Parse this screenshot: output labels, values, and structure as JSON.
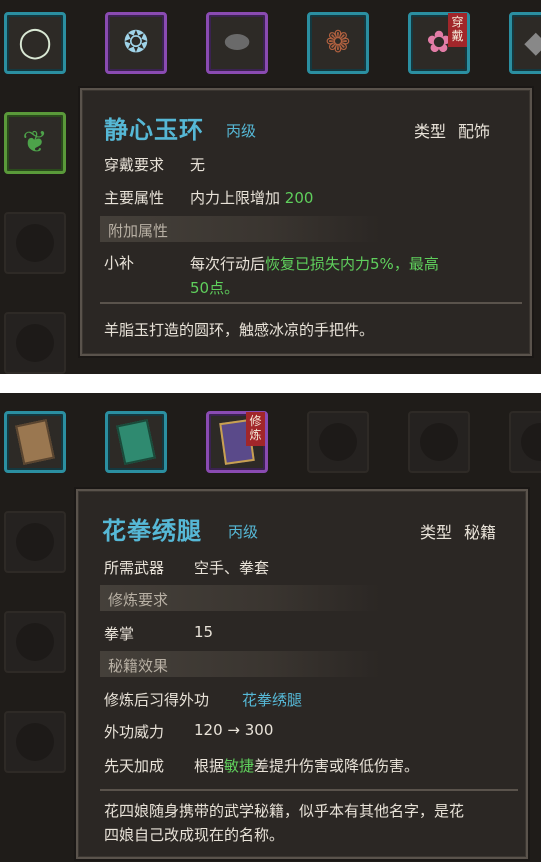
{
  "panel1": {
    "slots": [
      {
        "icon_name": "jade-ring-icon",
        "glyph": "◯",
        "color": "#d9e8d4"
      },
      {
        "icon_name": "jade-bracelet-icon",
        "glyph": "❂",
        "color": "#9fd3e8"
      },
      {
        "icon_name": "dark-leaf-icon",
        "glyph": "⬬",
        "color": "#5a5a5a"
      },
      {
        "icon_name": "prayer-beads-icon",
        "glyph": "❁",
        "color": "#a4553a"
      },
      {
        "icon_name": "peony-flower-icon",
        "glyph": "✿",
        "color": "#e27ca6",
        "tag": [
          "穿",
          "戴"
        ]
      },
      {
        "icon_name": "partial-item-icon",
        "glyph": "◆",
        "color": "#777"
      }
    ],
    "left_slot": {
      "icon_name": "herb-bundle-icon",
      "glyph": "❦",
      "color": "#4da24a"
    },
    "tooltip": {
      "title": "静心玉环",
      "grade": "丙级",
      "type_label": "类型",
      "type_value": "配饰",
      "rows": [
        {
          "label": "穿戴要求",
          "value": "无"
        },
        {
          "label": "主要属性",
          "value": "内力上限增加",
          "value_hl": "200"
        }
      ],
      "extra_header": "附加属性",
      "extra_label": "小补",
      "extra_text_a": "每次行动后",
      "extra_text_b": "恢复已损失内力5%，最高",
      "extra_text_c": "50点。",
      "description": "羊脂玉打造的圆环，触感冰凉的手把件。"
    }
  },
  "panel2": {
    "slots": [
      {
        "icon_name": "brown-book-icon",
        "glyph": "📔",
        "color": "#b08a5a"
      },
      {
        "icon_name": "green-book-icon",
        "glyph": "📗",
        "color": "#3a9a7a"
      },
      {
        "icon_name": "purple-scroll-book-icon",
        "glyph": "📘",
        "color": "#6a5aa0",
        "tag": [
          "修",
          "炼"
        ]
      }
    ],
    "tooltip": {
      "title": "花拳绣腿",
      "grade": "丙级",
      "type_label": "类型",
      "type_value": "秘籍",
      "weapon_label": "所需武器",
      "weapon_value": "空手、拳套",
      "req_header": "修炼要求",
      "req_label": "拳掌",
      "req_value": "15",
      "effect_header": "秘籍效果",
      "learn_label": "修炼后习得外功",
      "learn_value": "花拳绣腿",
      "power_label": "外功威力",
      "power_value": "120 → 300",
      "innate_label": "先天加成",
      "innate_a": "根据",
      "innate_hl": "敏捷",
      "innate_b": "差提升伤害或降低伤害。",
      "description_1": "花四娘随身携带的武学秘籍，似乎本有其他名字，是花",
      "description_2": "四娘自己改成现在的名称。"
    }
  }
}
